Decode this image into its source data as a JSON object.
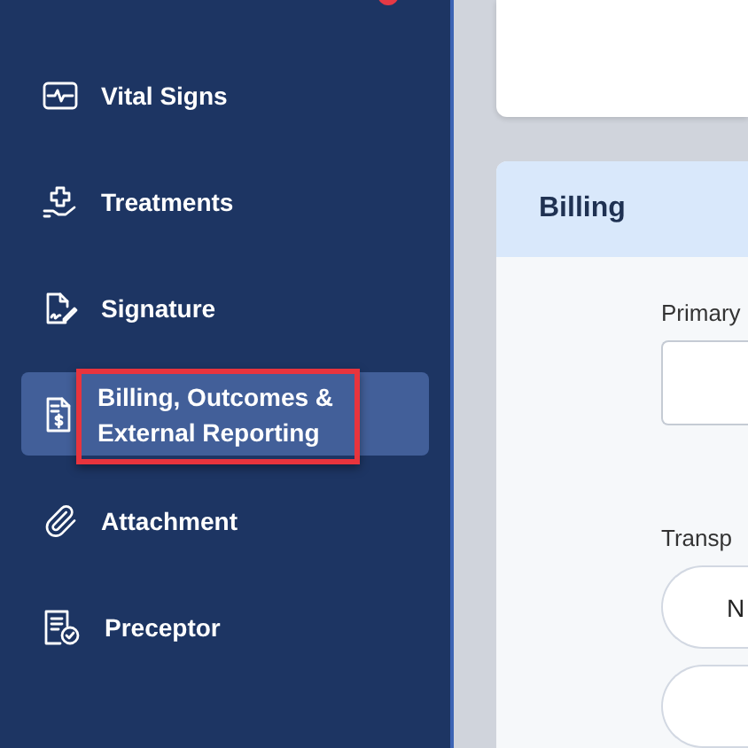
{
  "sidebar": {
    "items": [
      {
        "label": "Vital Signs",
        "selected": false,
        "highlighted": false
      },
      {
        "label": "Treatments",
        "selected": false,
        "highlighted": false
      },
      {
        "label": "Signature",
        "selected": false,
        "highlighted": false
      },
      {
        "label": "Billing, Outcomes & External Reporting",
        "selected": true,
        "highlighted": true
      },
      {
        "label": "Attachment",
        "selected": false,
        "highlighted": false
      },
      {
        "label": "Preceptor",
        "selected": false,
        "highlighted": false
      }
    ]
  },
  "billing": {
    "title": "Billing",
    "fields": [
      {
        "label": "Primary"
      }
    ],
    "transport": {
      "label": "Transp",
      "options": [
        {
          "kind": "pill",
          "label": "N"
        },
        {
          "kind": "pill"
        }
      ]
    }
  }
}
